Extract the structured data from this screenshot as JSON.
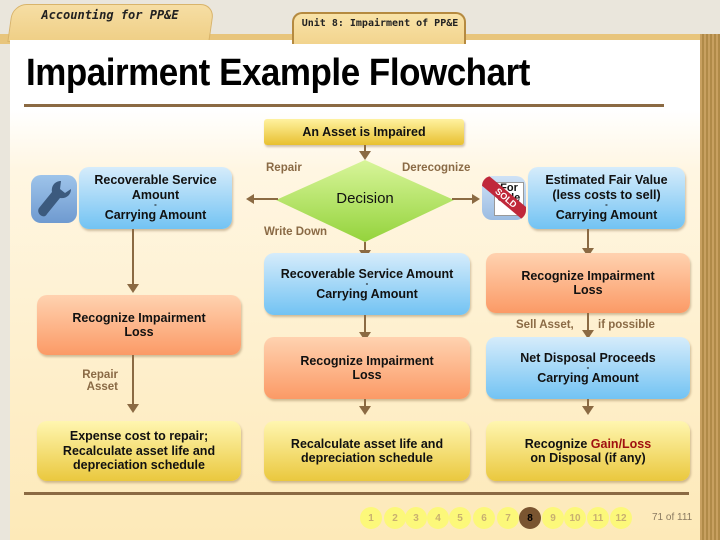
{
  "header": {
    "left_tab": "Accounting for PP&E",
    "right_tab": "Unit 8: Impairment of PP&E"
  },
  "title": "Impairment Example Flowchart",
  "flowchart": {
    "start": "An Asset is Impaired",
    "decision": "Decision",
    "branch_labels": {
      "repair": "Repair",
      "derecognize": "Derecognize",
      "write_down": "Write Down",
      "repair_asset_line1": "Repair",
      "repair_asset_line2": "Asset",
      "sell_asset": "Sell Asset,",
      "if_possible": "if possible"
    },
    "repair_branch": {
      "calc_line1": "Recoverable Service",
      "calc_line2": "Amount",
      "calc_minus": "-",
      "calc_line3": "Carrying Amount",
      "loss_line1": "Recognize Impairment",
      "loss_line2": "Loss",
      "result_line1": "Expense cost to repair;",
      "result_line2": "Recalculate asset life and",
      "result_line3": "depreciation schedule"
    },
    "writedown_branch": {
      "calc_line1": "Recoverable Service Amount",
      "calc_minus": "-",
      "calc_line2": "Carrying Amount",
      "loss_line1": "Recognize Impairment",
      "loss_line2": "Loss",
      "result_line1": "Recalculate asset life and",
      "result_line2": "depreciation schedule"
    },
    "derecognize_branch": {
      "calc_line1": "Estimated Fair Value",
      "calc_line2": "(less costs to sell)",
      "calc_minus": "-",
      "calc_line3": "Carrying Amount",
      "loss_line1": "Recognize Impairment",
      "loss_line2": "Loss",
      "disposal_line1": "Net Disposal Proceeds",
      "disposal_minus": "-",
      "disposal_line2": "Carrying Amount",
      "result_prefix": "Recognize ",
      "result_highlight": "Gain/Loss",
      "result_line2": "on Disposal (if any)"
    },
    "icons": {
      "repair": "wrench-icon",
      "sale": "for-sale-sold-sign-icon",
      "sign_text_top": "For",
      "sign_text_bottom": "Sale",
      "sold_text": "SOLD"
    }
  },
  "pager": {
    "pages": [
      "1",
      "2",
      "3",
      "4",
      "5",
      "6",
      "7",
      "8",
      "9",
      "10",
      "11",
      "12"
    ],
    "current": "8",
    "slide_count": "71 of 111"
  },
  "colors": {
    "connector": "#8b6a43",
    "highlight": "#a01010",
    "active_page": "#7a5530"
  }
}
